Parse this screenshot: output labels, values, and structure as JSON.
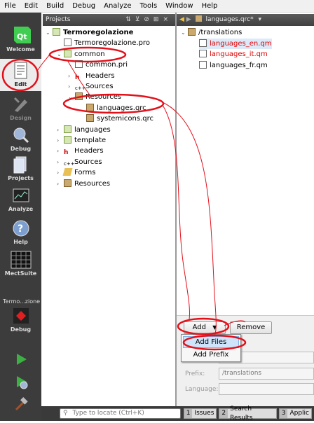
{
  "menu": [
    "File",
    "Edit",
    "Build",
    "Debug",
    "Analyze",
    "Tools",
    "Window",
    "Help"
  ],
  "modes": [
    {
      "label": "Welcome",
      "icon": "qt-logo-icon"
    },
    {
      "label": "Edit",
      "icon": "edit-document-icon"
    },
    {
      "label": "Design",
      "icon": "design-pencil-icon"
    },
    {
      "label": "Debug",
      "icon": "debug-bug-icon"
    },
    {
      "label": "Projects",
      "icon": "projects-icon"
    },
    {
      "label": "Analyze",
      "icon": "analyze-icon"
    },
    {
      "label": "Help",
      "icon": "help-icon"
    },
    {
      "label": "MectSuite",
      "icon": "mectsuite-grid-icon"
    }
  ],
  "target": {
    "project": "Termo...zione",
    "config": "Debug"
  },
  "projects_pane": {
    "title": "Projects"
  },
  "tree": [
    {
      "label": "Termoregolazione",
      "indent": 0,
      "twisty": "⌄",
      "icon": "qt",
      "bold": true
    },
    {
      "label": "Termoregolazione.pro",
      "indent": 1,
      "twisty": "",
      "icon": "doc"
    },
    {
      "label": "common",
      "indent": 1,
      "twisty": "⌄",
      "icon": "qt"
    },
    {
      "label": "common.pri",
      "indent": 2,
      "twisty": "",
      "icon": "doc"
    },
    {
      "label": "Headers",
      "indent": 2,
      "twisty": "›",
      "icon": "h"
    },
    {
      "label": "Sources",
      "indent": 2,
      "twisty": "›",
      "icon": "c"
    },
    {
      "label": "Resources",
      "indent": 2,
      "twisty": "⌄",
      "icon": "lock"
    },
    {
      "label": "languages.qrc",
      "indent": 3,
      "twisty": "",
      "icon": "lock"
    },
    {
      "label": "systemicons.qrc",
      "indent": 3,
      "twisty": "",
      "icon": "lock"
    },
    {
      "label": "languages",
      "indent": 1,
      "twisty": "›",
      "icon": "qt"
    },
    {
      "label": "template",
      "indent": 1,
      "twisty": "›",
      "icon": "qt"
    },
    {
      "label": "Headers",
      "indent": 1,
      "twisty": "›",
      "icon": "h"
    },
    {
      "label": "Sources",
      "indent": 1,
      "twisty": "›",
      "icon": "c"
    },
    {
      "label": "Forms",
      "indent": 1,
      "twisty": "›",
      "icon": "form"
    },
    {
      "label": "Resources",
      "indent": 1,
      "twisty": "›",
      "icon": "lock"
    }
  ],
  "editor": {
    "file_tab": "languages.qrc*"
  },
  "resource_tree": [
    {
      "label": "/translations",
      "indent": 0,
      "color": "#000"
    },
    {
      "label": "languages_en.qm",
      "indent": 1,
      "color": "#e00000",
      "selected": true
    },
    {
      "label": "languages_it.qm",
      "indent": 1,
      "color": "#e00000"
    },
    {
      "label": "languages_fr.qm",
      "indent": 1,
      "color": "#000"
    }
  ],
  "buttons": {
    "add": "Add",
    "remove": "Remove"
  },
  "add_menu": [
    "Add Files",
    "Add Prefix"
  ],
  "props": {
    "prefix_label": "Prefix:",
    "prefix_value": "/translations",
    "language_label": "Language:"
  },
  "locator": {
    "placeholder": "Type to locate (Ctrl+K)"
  },
  "status_tabs": [
    {
      "num": "1",
      "label": "Issues"
    },
    {
      "num": "2",
      "label": "Search Results"
    },
    {
      "num": "3",
      "label": "Applic"
    }
  ]
}
